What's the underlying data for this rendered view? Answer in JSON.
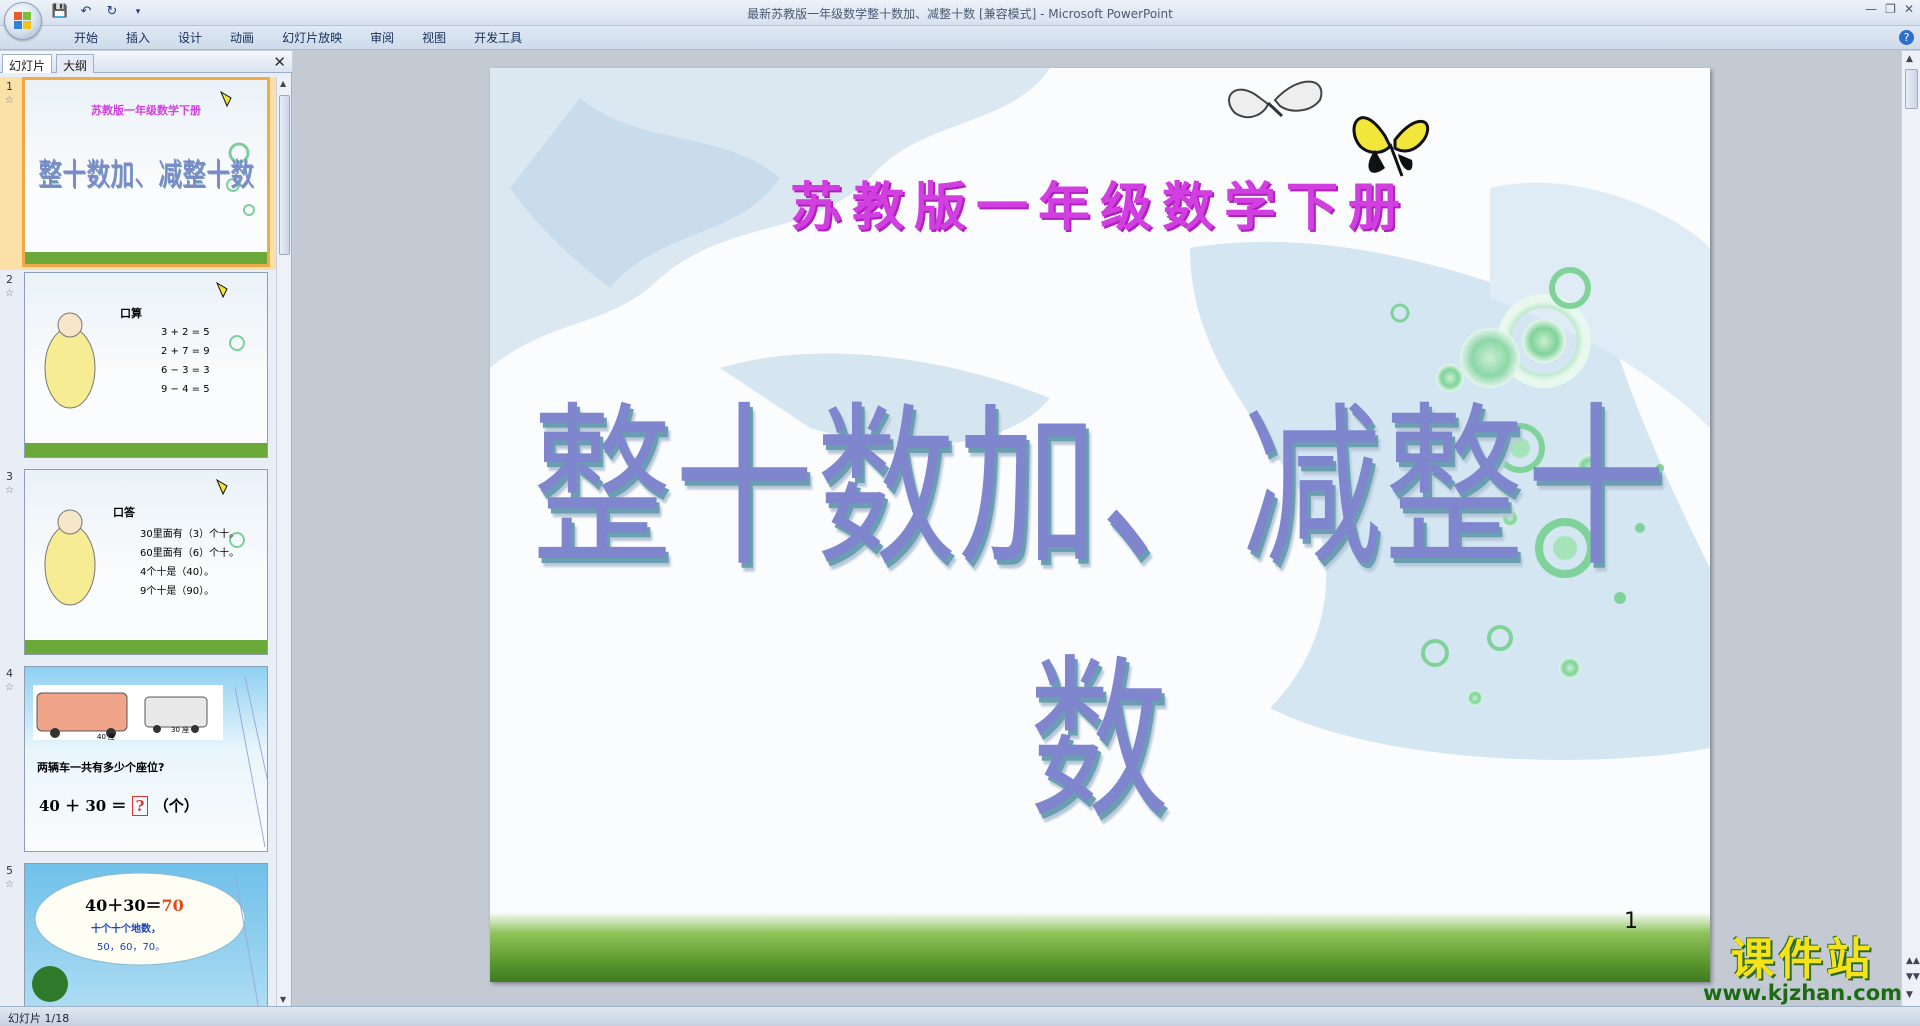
{
  "window": {
    "title": "最新苏教版一年级数学整十数加、减整十数 [兼容模式] - Microsoft PowerPoint"
  },
  "ribbon_tabs": [
    "开始",
    "插入",
    "设计",
    "动画",
    "幻灯片放映",
    "审阅",
    "视图",
    "开发工具"
  ],
  "panel_tabs": {
    "slides": "幻灯片",
    "outline": "大纲"
  },
  "thumbnails": [
    {
      "num": "1",
      "line1": "苏教版一年级数学下册",
      "line2": "整十数加、减整十数"
    },
    {
      "num": "2",
      "heading": "口算",
      "items": [
        "3 + 2 =  5",
        "2 + 7 =  9",
        "6 − 3 =  3",
        "9 − 4 =  5"
      ]
    },
    {
      "num": "3",
      "heading": "口答",
      "items": [
        "30里面有（3）个十。",
        "60里面有（6）个十。",
        "4个十是（40）。",
        "9个十是（90）。"
      ]
    },
    {
      "num": "4",
      "bus1": "40 座",
      "bus2": "30 座",
      "question": "两辆车一共有多少个座位?",
      "equation": "40 ＋ 30 ＝",
      "box": "?",
      "unit": "（个）"
    },
    {
      "num": "5",
      "line1a": "40＋30＝",
      "line1b": "70",
      "line2": "十个十个地数，",
      "line3": "50，60，70。"
    }
  ],
  "slide": {
    "subtitle": "苏教版一年级数学下册",
    "title": "整十数加、减整十数",
    "number": "1"
  },
  "watermark": {
    "cn": "课件站",
    "url": "www.kjzhan.com"
  },
  "status": {
    "slide_count": "幻灯片 1/18"
  },
  "colors": {
    "subtitle": "#d23fe0",
    "title": "#7f86ce",
    "thumb_selected": "#f2a94a"
  }
}
